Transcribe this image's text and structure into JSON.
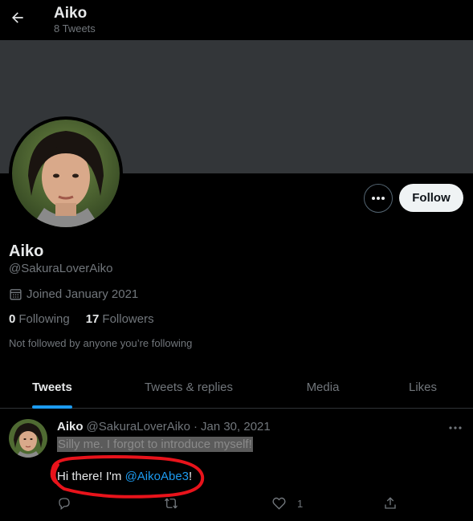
{
  "header": {
    "title": "Aiko",
    "subtitle": "8 Tweets"
  },
  "profile": {
    "name": "Aiko",
    "handle": "@SakuraLoverAiko",
    "joined": "Joined January 2021",
    "following_count": "0",
    "following_label": "Following",
    "followers_count": "17",
    "followers_label": "Followers",
    "not_followed": "Not followed by anyone you’re following",
    "follow_label": "Follow"
  },
  "tabs": [
    {
      "label": "Tweets",
      "active": true
    },
    {
      "label": "Tweets & replies",
      "active": false
    },
    {
      "label": "Media",
      "active": false
    },
    {
      "label": "Likes",
      "active": false
    }
  ],
  "tweet": {
    "name": "Aiko",
    "handle": "@SakuraLoverAiko",
    "separator": "·",
    "date": "Jan 30, 2021",
    "line1": "Silly me. I forgot to introduce myself!",
    "line2_prefix": "Hi there! I'm ",
    "mention": "@AikoAbe3",
    "line2_suffix": "!",
    "like_count": "1"
  },
  "colors": {
    "background": "#000000",
    "banner": "#333639",
    "accent": "#1d9bf0",
    "annotation": "#e8131b"
  },
  "icons": [
    "back-arrow-icon",
    "more-icon",
    "calendar-icon",
    "reply-icon",
    "retweet-icon",
    "like-icon",
    "share-icon"
  ]
}
